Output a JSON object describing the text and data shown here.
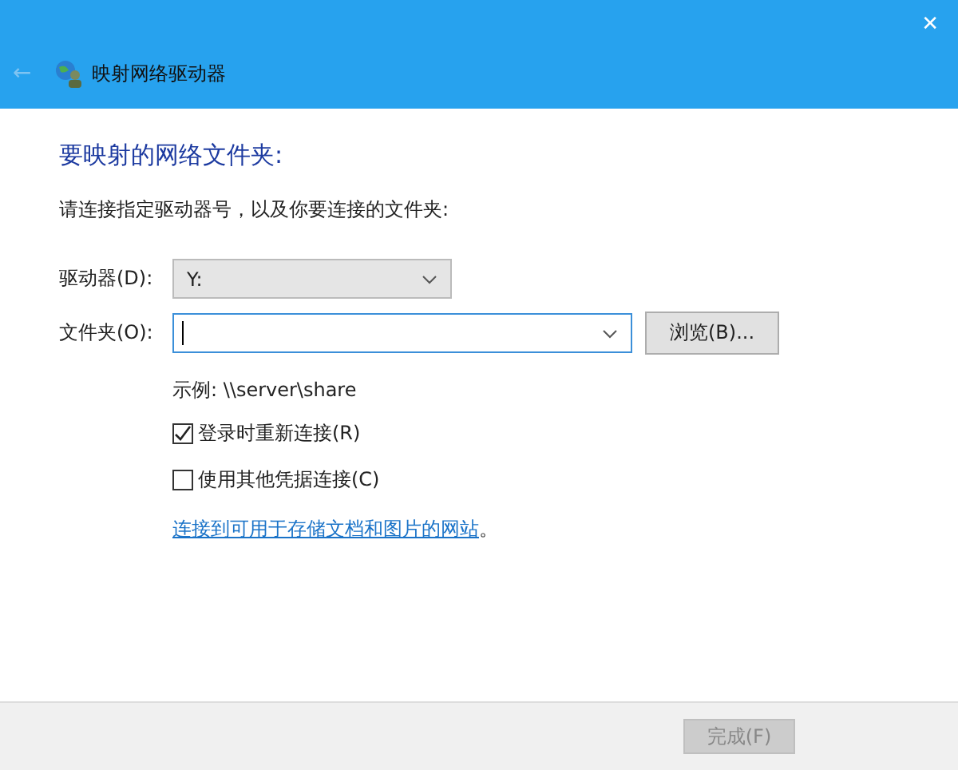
{
  "window": {
    "close": "✕",
    "back": "←",
    "title": "映射网络驱动器"
  },
  "heading": "要映射的网络文件夹:",
  "instruction": "请连接指定驱动器号，以及你要连接的文件夹:",
  "drive": {
    "label": "驱动器(D):",
    "value": "Y:"
  },
  "folder": {
    "label": "文件夹(O):",
    "focused": true,
    "browse": "浏览(B)..."
  },
  "example": "示例: \\\\server\\share",
  "options": [
    {
      "label": "登录时重新连接(R)",
      "checked": true
    },
    {
      "label": "使用其他凭据连接(C)",
      "checked": false
    }
  ],
  "link": {
    "text": "连接到可用于存储文档和图片的网站",
    "suffix": "。"
  },
  "footer": {
    "finish": {
      "label": "完成(F)",
      "disabled": true
    }
  }
}
